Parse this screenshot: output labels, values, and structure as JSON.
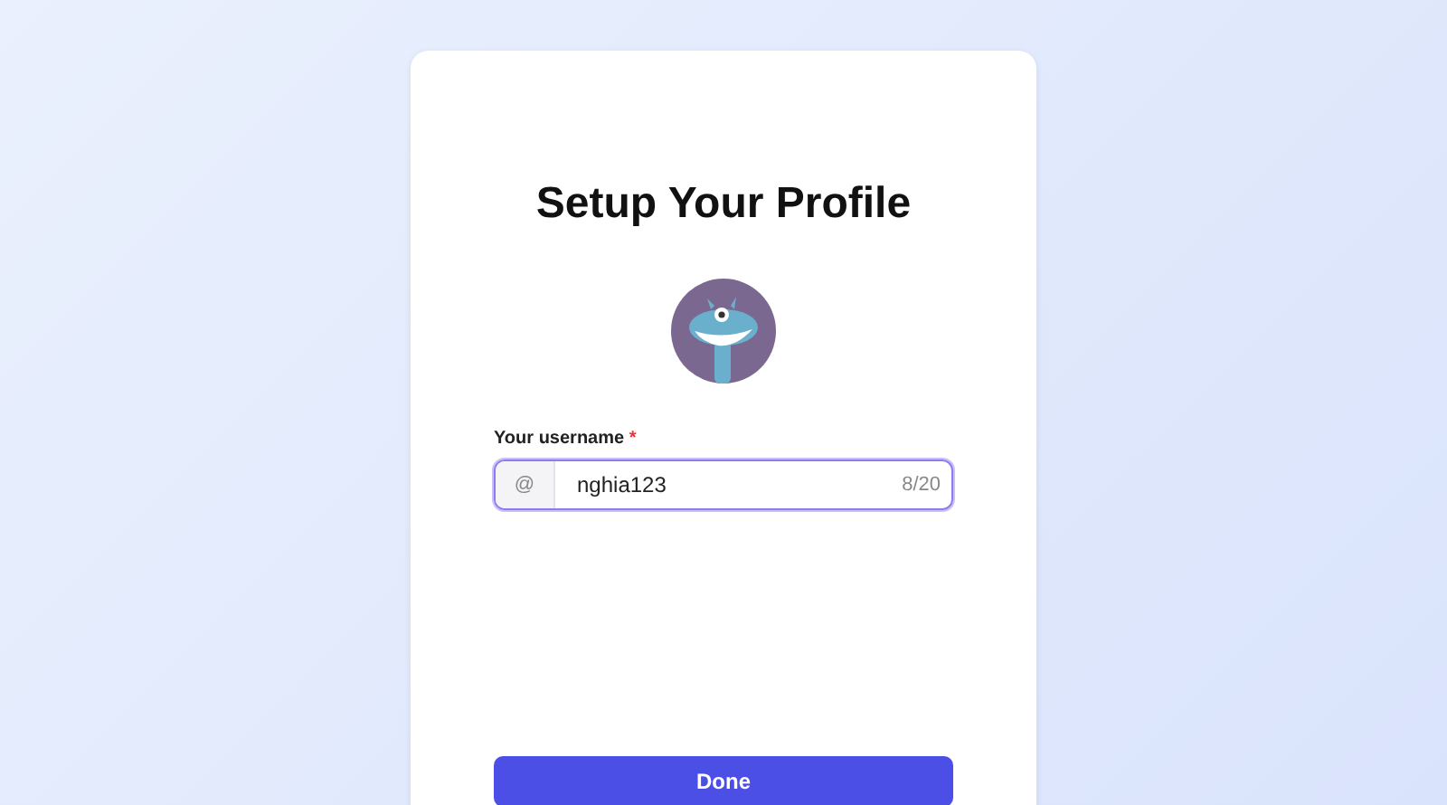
{
  "title": "Setup Your Profile",
  "username": {
    "label": "Your username",
    "required_mark": "*",
    "prefix": "@",
    "value": "nghia123",
    "counter": "8/20",
    "focused": true
  },
  "button": "Done"
}
